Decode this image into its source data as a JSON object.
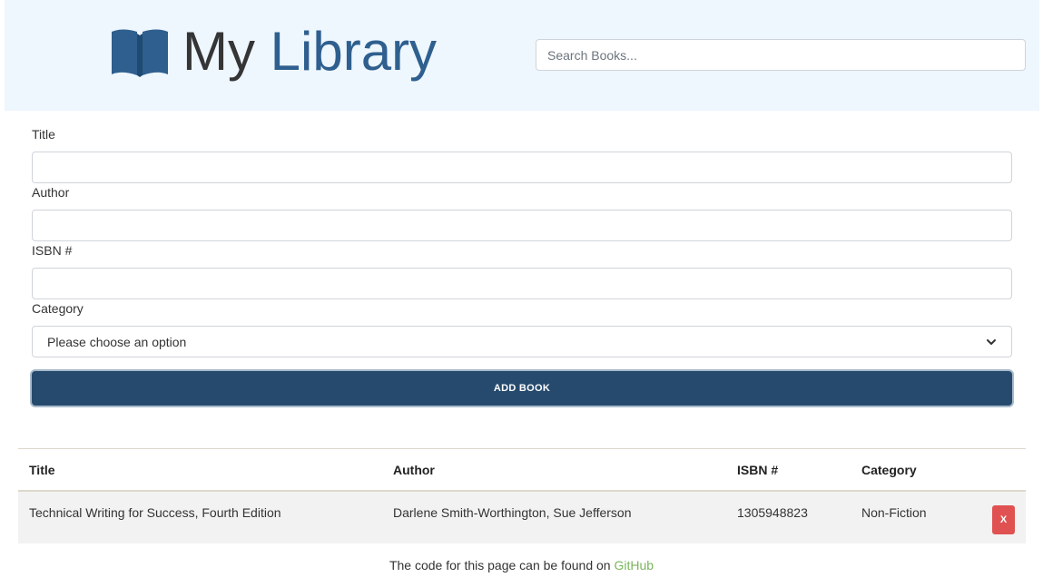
{
  "header": {
    "logo_prefix": "My ",
    "logo_accent": "Library",
    "icon": "open-book-icon",
    "search_placeholder": "Search Books..."
  },
  "form": {
    "title_label": "Title",
    "author_label": "Author",
    "isbn_label": "ISBN #",
    "category_label": "Category",
    "category_selected": "Please choose an option",
    "submit_label": "ADD BOOK"
  },
  "table": {
    "headers": [
      "Title",
      "Author",
      "ISBN #",
      "Category"
    ],
    "rows": [
      {
        "title": "Technical Writing for Success, Fourth Edition",
        "author": "Darlene Smith-Worthington, Sue Jefferson",
        "isbn": "1305948823",
        "category": "Non-Fiction",
        "delete_label": "X"
      }
    ]
  },
  "footer": {
    "text": "The code for this page can be found on ",
    "link_text": "GitHub"
  },
  "colors": {
    "header_bg": "#eef6fe",
    "brand": "#2e5f8e",
    "button": "#264a6d",
    "danger": "#e05252",
    "link": "#7ab55c"
  }
}
